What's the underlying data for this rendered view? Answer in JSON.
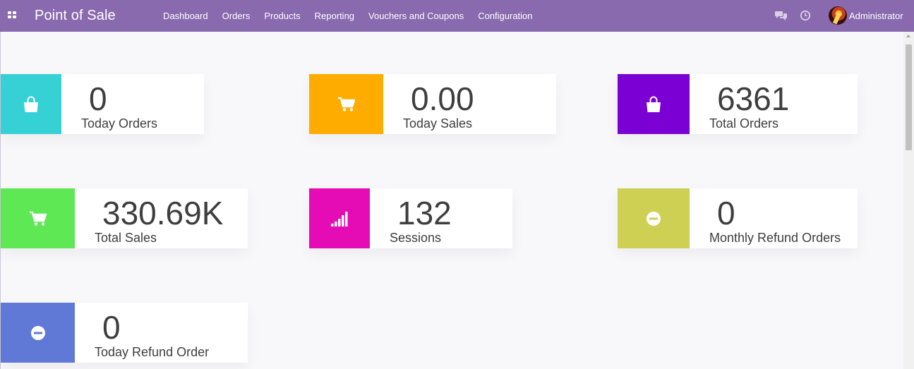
{
  "navbar": {
    "app_title": "Point of Sale",
    "menu": [
      "Dashboard",
      "Orders",
      "Products",
      "Reporting",
      "Vouchers and Coupons",
      "Configuration"
    ],
    "user_name": "Administrator",
    "icons": {
      "apps": "apps-grid-icon",
      "chat": "chat-icon",
      "activity": "clock-icon"
    },
    "background_color": "#8a6aaf"
  },
  "tiles": [
    {
      "value": "0",
      "label": "Today Orders",
      "color": "#35d1d5",
      "icon": "shopping-bag-icon"
    },
    {
      "value": "0.00",
      "label": "Today Sales",
      "color": "#ffac00",
      "icon": "shopping-cart-icon"
    },
    {
      "value": "6361",
      "label": "Total Orders",
      "color": "#7a00d4",
      "icon": "shopping-bag-icon"
    },
    {
      "value": "330.69K",
      "label": "Total Sales",
      "color": "#5ee853",
      "icon": "shopping-cart-icon"
    },
    {
      "value": "132",
      "label": "Sessions",
      "color": "#e50bb5",
      "icon": "signal-bars-icon"
    },
    {
      "value": "0",
      "label": "Monthly Refund Orders",
      "color": "#cdd052",
      "icon": "minus-circle-icon"
    },
    {
      "value": "0",
      "label": "Today Refund Order",
      "color": "#6179d6",
      "icon": "minus-circle-icon"
    }
  ]
}
